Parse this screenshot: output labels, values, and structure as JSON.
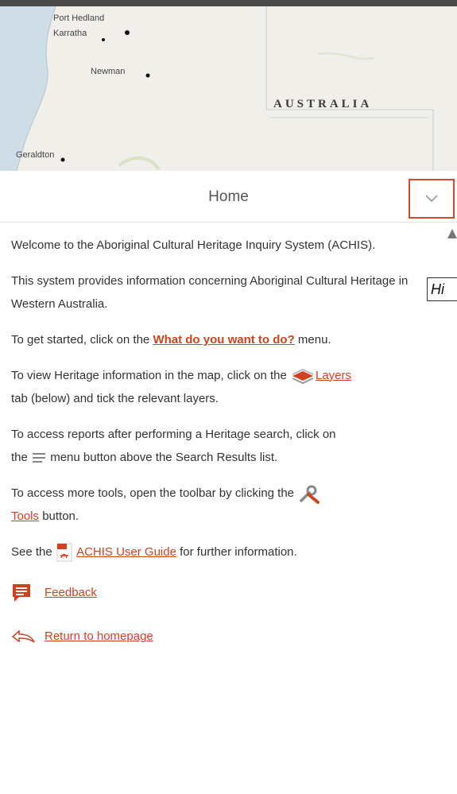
{
  "map": {
    "cities": [
      "Port Hedland",
      "Karratha",
      "Newman",
      "Geraldton"
    ],
    "country": "AUSTRALIA"
  },
  "header": {
    "title": "Home"
  },
  "tooltip": {
    "text": "Hi"
  },
  "content": {
    "p1": "Welcome to the Aboriginal Cultural Heritage Inquiry System (ACHIS).",
    "p2": "This system provides information concerning Aboriginal Cultural Heritage in Western Australia.",
    "p3_before": "To get started, click on the ",
    "p3_link": "What do you want to do?",
    "p3_after": " menu.",
    "p4_before": "To view Heritage information in the map, click on the ",
    "p4_link": "Layers",
    "p4_after": "tab (below) and tick the relevant layers.",
    "p5_line1": "To access reports after performing a Heritage search, click on",
    "p5_before": "the ",
    "p5_after": " menu button above the Search Results list.",
    "p6_before": "To access more tools, open the toolbar by clicking the ",
    "p6_link": "Tools",
    "p6_after": " button.",
    "p7_before": "See the ",
    "p7_link": "ACHIS User Guide",
    "p7_after": " for further information."
  },
  "footer": {
    "feedback": "Feedback",
    "return": "Return to homepage"
  },
  "colors": {
    "accent": "#d0421f",
    "highlight_border": "#d8482b"
  }
}
